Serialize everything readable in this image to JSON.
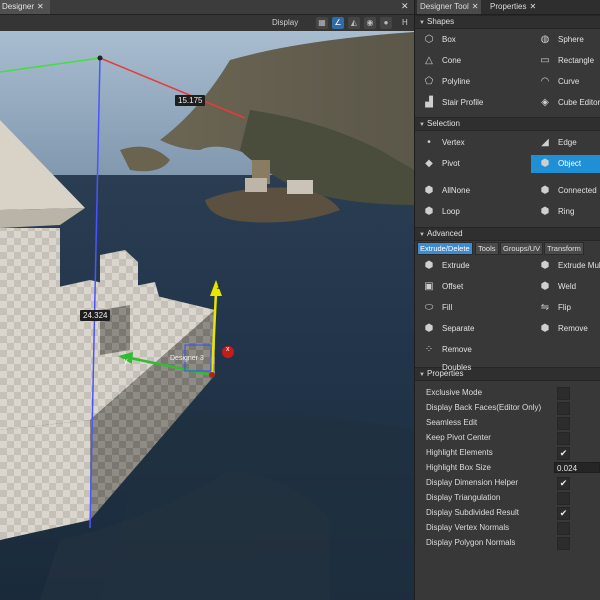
{
  "viewport": {
    "tab_label": "Designer",
    "tab_close": "✕",
    "display_label": "Display",
    "toolbar_h": "H",
    "close_glyph": "✕",
    "dimension_top": "15.175",
    "dimension_side": "24.324",
    "object_label": "Designer 3",
    "axis_x": "x",
    "axis_y": "y",
    "axis_z": "z"
  },
  "panel": {
    "tabs": [
      {
        "label": "Designer Tool",
        "close": "✕"
      },
      {
        "label": "Properties",
        "close": "✕"
      }
    ],
    "shapes": {
      "title": "Shapes",
      "items": [
        {
          "label": "Box",
          "icon": "box-icon",
          "glyph": "⬡"
        },
        {
          "label": "Sphere",
          "icon": "sphere-icon",
          "glyph": "◍"
        },
        {
          "label": "Cone",
          "icon": "cone-icon",
          "glyph": "△"
        },
        {
          "label": "Rectangle",
          "icon": "rectangle-icon",
          "glyph": "▭"
        },
        {
          "label": "Polyline",
          "icon": "polyline-icon",
          "glyph": "⬠"
        },
        {
          "label": "Curve",
          "icon": "curve-icon",
          "glyph": "◠"
        },
        {
          "label": "Stair Profile",
          "icon": "stair-icon",
          "glyph": "▟"
        },
        {
          "label": "Cube Editor",
          "icon": "cube-editor-icon",
          "glyph": "◈"
        }
      ]
    },
    "selection": {
      "title": "Selection",
      "items": [
        {
          "label": "Vertex",
          "icon": "vertex-icon",
          "glyph": "•"
        },
        {
          "label": "Edge",
          "icon": "edge-icon",
          "glyph": "◢"
        },
        {
          "label": "Pivot",
          "icon": "pivot-icon",
          "glyph": "◆"
        },
        {
          "label": "Object",
          "icon": "object-icon",
          "glyph": "⬢",
          "selected": true
        },
        {
          "label": "AllNone",
          "icon": "all-none-icon",
          "glyph": "⬢"
        },
        {
          "label": "Connected",
          "icon": "connected-icon",
          "glyph": "⬢"
        },
        {
          "label": "Loop",
          "icon": "loop-icon",
          "glyph": "⬢"
        },
        {
          "label": "Ring",
          "icon": "ring-icon",
          "glyph": "⬢"
        }
      ]
    },
    "advanced": {
      "title": "Advanced",
      "subtabs": [
        {
          "label": "Extrude/Delete",
          "active": true
        },
        {
          "label": "Tools"
        },
        {
          "label": "Groups/UV"
        },
        {
          "label": "Transform"
        }
      ],
      "items": [
        {
          "label": "Extrude",
          "icon": "extrude-icon",
          "glyph": "⬢"
        },
        {
          "label": "Extrude Multiple",
          "icon": "extrude-multiple-icon",
          "glyph": "⬢"
        },
        {
          "label": "Offset",
          "icon": "offset-icon",
          "glyph": "▣"
        },
        {
          "label": "Weld",
          "icon": "weld-icon",
          "glyph": "⬢"
        },
        {
          "label": "Fill",
          "icon": "fill-icon",
          "glyph": "⬭"
        },
        {
          "label": "Flip",
          "icon": "flip-icon",
          "glyph": "⇋"
        },
        {
          "label": "Separate",
          "icon": "separate-icon",
          "glyph": "⬢"
        },
        {
          "label": "Remove",
          "icon": "remove-icon",
          "glyph": "⬢"
        },
        {
          "label": "Remove Doubles",
          "icon": "remove-doubles-icon",
          "glyph": "⁘"
        }
      ]
    },
    "properties": {
      "title": "Properties",
      "rows": [
        {
          "label": "Exclusive Mode",
          "checked": false
        },
        {
          "label": "Display Back Faces(Editor Only)",
          "checked": false
        },
        {
          "label": "Seamless Edit",
          "checked": false
        },
        {
          "label": "Keep Pivot Center",
          "checked": false
        },
        {
          "label": "Highlight Elements",
          "checked": true
        },
        {
          "label": "Highlight Box Size",
          "value": "0.024"
        },
        {
          "label": "Display Dimension Helper",
          "checked": true
        },
        {
          "label": "Display Triangulation",
          "checked": false
        },
        {
          "label": "Display Subdivided Result",
          "checked": true
        },
        {
          "label": "Display Vertex Normals",
          "checked": false
        },
        {
          "label": "Display Polygon Normals",
          "checked": false
        }
      ]
    }
  },
  "colors": {
    "accent": "#1f8fd6",
    "subtab_active": "#3d8bd0",
    "panel_bg": "#383838",
    "section_bg": "#2f2f2f"
  }
}
